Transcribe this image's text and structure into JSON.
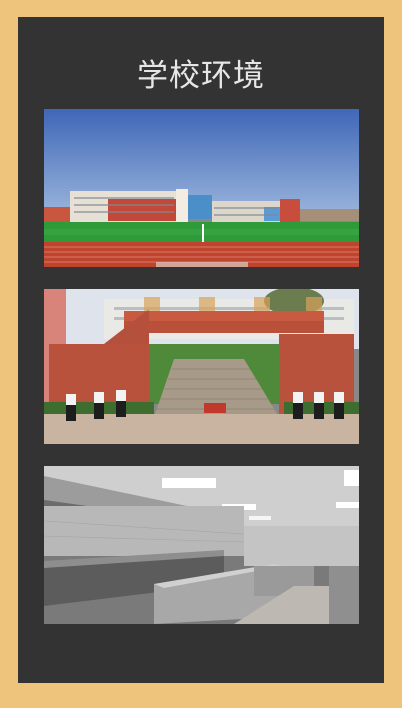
{
  "page": {
    "title": "学校环境",
    "background_color": "#eec47c",
    "panel_color": "#333333"
  },
  "photos": [
    {
      "subject": "school-building-and-sports-field"
    },
    {
      "subject": "school-gate-with-staff"
    },
    {
      "subject": "canteen-kitchen"
    }
  ]
}
